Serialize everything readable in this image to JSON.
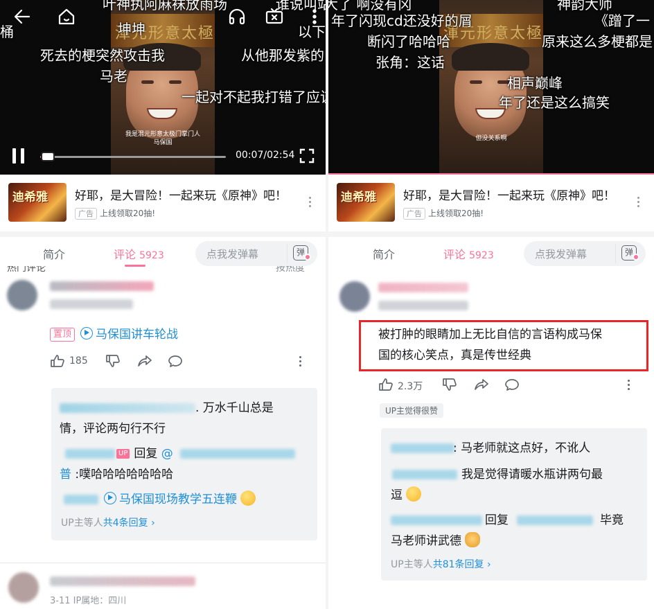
{
  "left": {
    "danmaku": [
      "叶神执阿麻袜放雨场",
      "谁说叫站",
      "桶",
      "坤坤",
      "以下",
      "死去的梗突然攻击我",
      "从他那发紫的",
      "马老",
      "一起对不起我打错了应该"
    ],
    "video_caption": [
      "我是混元形意太极门掌门人",
      "马保国"
    ],
    "banner_text": "渾元形意太極",
    "time": "00:07/02:54",
    "progress": 0.04,
    "ad": {
      "thumb_text": "迪希雅",
      "title": "好耶，是大冒险！一起来玩《原神》吧！",
      "tag": "广告",
      "subtitle": "上线领取20抽!"
    },
    "tabs": {
      "intro": "简介",
      "comments": "评论",
      "comment_count": "5923",
      "danmaku_placeholder": "点我发弹幕",
      "danmaku_btn": "弹"
    },
    "section_left": "热门评论",
    "section_right": "按热度",
    "comment1": {
      "pin": "置顶",
      "link": "马保国讲车轮战",
      "likes": "185",
      "replies": {
        "line1": ". 万水千山总是",
        "line2": "情，评论两句行不行",
        "up": "UP",
        "reply_word": "回复",
        "at": "@",
        "line3": "普 :噗哈哈哈哈哈哈哈",
        "link2": "马保国现场教学五连鞭",
        "more_prefix": "UP主等人",
        "more_count": "共4条回复"
      }
    },
    "comment2": {
      "meta": "3-11  IP属地：四川"
    }
  },
  "right": {
    "danmaku": [
      "神韵大师",
      "大了 啊没有冈",
      "年了闪现cd还没好的屑",
      "《蹭了一",
      "断闪了哈哈哈",
      "原来这么多梗都是",
      "张角：这话",
      "相声巅峰",
      "年了还是这么搞笑"
    ],
    "video_caption": "但没关系啊",
    "banner_text": "渾元形意太極",
    "ad": {
      "thumb_text": "迪希雅",
      "title": "好耶，是大冒险！一起来玩《原神》吧！",
      "tag": "广告",
      "subtitle": "上线领取20抽!"
    },
    "tabs": {
      "intro": "简介",
      "comments": "评论",
      "comment_count": "5923",
      "danmaku_placeholder": "点我发弹幕",
      "danmaku_btn": "弹"
    },
    "comment1": {
      "text_line1": "被打肿的眼睛加上无比自信的言语构成马保",
      "text_line2": "国的核心笑点，真是传世经典",
      "likes": "2.3万",
      "up_liked": "UP主觉得很赞",
      "replies": {
        "line1": ": 马老师就这点好，不讹人",
        "line2": "我是觉得请暖水瓶讲两句最",
        "line3": "逗",
        "reply_word": "回复",
        "line4_tail": "毕竟",
        "line5": "马老师讲武德",
        "more_prefix": "UP主等人",
        "more_count": "共81条回复"
      }
    }
  }
}
